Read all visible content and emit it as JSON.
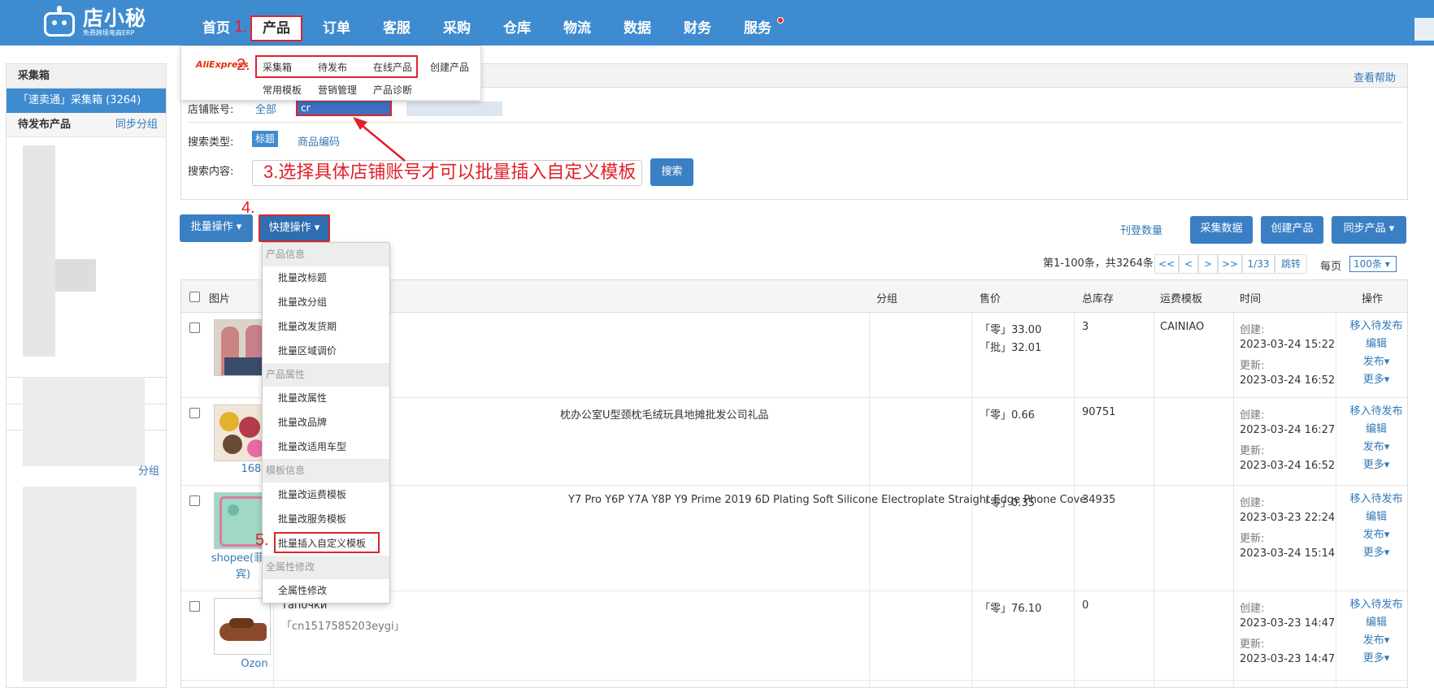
{
  "header": {
    "brand": "店小秘",
    "brand_sub": "免费跨境电商ERP",
    "nav": [
      "首页",
      "产品",
      "订单",
      "客服",
      "采购",
      "仓库",
      "物流",
      "数据",
      "财务",
      "服务"
    ],
    "annotations": {
      "n1": "1.",
      "n2": "2.",
      "n3": "3.选择具体店铺账号才可以批量插入自定义模板",
      "n4": "4.",
      "n5": "5."
    }
  },
  "product_menu": {
    "platform_logo": "AliExpress",
    "row1": [
      "采集箱",
      "待发布",
      "在线产品",
      "创建产品"
    ],
    "row2": [
      "常用模板",
      "营销管理",
      "产品诊断"
    ]
  },
  "sidebar": {
    "section1": "采集箱",
    "active_item": "「速卖通」采集箱 (3264)",
    "section2": "待发布产品",
    "section2_link": "同步分组",
    "section3_link": "分组"
  },
  "search": {
    "help_link": "查看帮助",
    "store_label": "店铺账号:",
    "store_all": "全部",
    "store_selected": "cr",
    "type_label": "搜索类型:",
    "type_title": "标题",
    "type_code": "商品编码",
    "content_label": "搜索内容:",
    "search_button": "搜索"
  },
  "toolbar": {
    "batch_ops": "批量操作",
    "quick_ops": "快捷操作",
    "listing_count": "刊登数量",
    "collect_data": "采集数据",
    "create_product": "创建产品",
    "sync_product": "同步产品"
  },
  "pager": {
    "summary": "第1-100条，共3264条",
    "first": "<<",
    "prev": "<",
    "next": ">",
    "last": ">>",
    "page": "1/33",
    "jump": "跳转",
    "per_page_label": "每页",
    "per_page_value": "100条"
  },
  "quick_menu": {
    "groups": [
      {
        "header": "产品信息",
        "items": [
          "批量改标题",
          "批量改分组",
          "批量改发货期",
          "批量区域调价"
        ]
      },
      {
        "header": "产品属性",
        "items": [
          "批量改属性",
          "批量改品牌",
          "批量改适用车型"
        ]
      },
      {
        "header": "模板信息",
        "items": [
          "批量改运费模板",
          "批量改服务模板",
          "批量插入自定义模板"
        ]
      },
      {
        "header": "全属性修改",
        "items": [
          "全属性修改"
        ]
      }
    ]
  },
  "table": {
    "headers": [
      "图片",
      "分组",
      "售价",
      "总库存",
      "运费模板",
      "时间",
      "操作"
    ],
    "rows": [
      {
        "source": "",
        "title": "",
        "code": "",
        "prices": [
          "「零」33.00",
          "「批」32.01"
        ],
        "stock": "3",
        "shipping": "CAINIAO",
        "created_label": "创建:",
        "created": "2023-03-24 15:22",
        "updated_label": "更新:",
        "updated": "2023-03-24 16:52"
      },
      {
        "source": "1688",
        "title": "枕办公室U型颈枕毛绒玩具地摊批发公司礼品",
        "code": "",
        "prices": [
          "「零」0.66"
        ],
        "stock": "90751",
        "shipping": "",
        "created_label": "创建:",
        "created": "2023-03-24 16:27",
        "updated_label": "更新:",
        "updated": "2023-03-24 16:52"
      },
      {
        "source": "shopee(菲律宾)",
        "title": "Y7 Pro Y6P Y7A Y8P Y9 Prime 2019 6D Plating Soft Silicone Electroplate Straight Edge Phone Cove",
        "code": "",
        "prices": [
          "「零」0.35"
        ],
        "stock": "34935",
        "shipping": "",
        "created_label": "创建:",
        "created": "2023-03-23 22:24",
        "updated_label": "更新:",
        "updated": "2023-03-24 15:14"
      },
      {
        "source": "Ozon",
        "title": "Тапочки",
        "code": "「cn1517585203eygi」",
        "prices": [
          "「零」76.10"
        ],
        "stock": "0",
        "shipping": "",
        "created_label": "创建:",
        "created": "2023-03-23 14:47",
        "updated_label": "更新:",
        "updated": "2023-03-23 14:47"
      }
    ],
    "ops": [
      "移入待发布",
      "编辑",
      "发布▾",
      "更多▾"
    ]
  }
}
